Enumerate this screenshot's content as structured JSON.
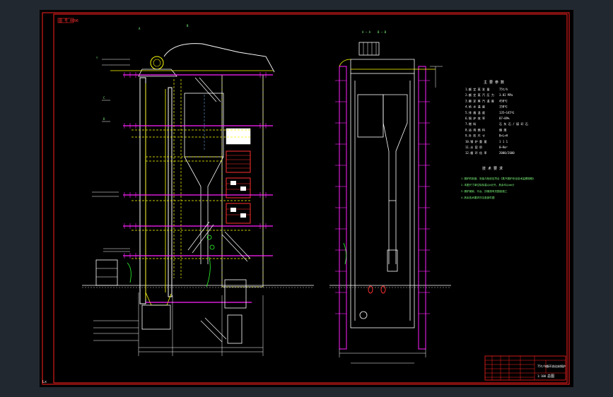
{
  "drawing": {
    "corner_tag": "图 号 0096",
    "view_label_left": "A — A",
    "view_label_right": "B — B",
    "spec_title": "主 要 参 数",
    "notes_title": "技 术 要 求",
    "spec_rows": [
      {
        "key": "1.额 定 蒸 发 量",
        "val": "75t/h"
      },
      {
        "key": "2.额 定 蒸 汽 压 力",
        "val": "3.82 MPa"
      },
      {
        "key": "3.额 定 蒸 汽 温 度",
        "val": "450℃"
      },
      {
        "key": "4.给 水 温 度",
        "val": "150℃"
      },
      {
        "key": "5.排 烟 温 度",
        "val": "135~145℃"
      },
      {
        "key": "6.锅 炉 效 率",
        "val": "87~89%"
      },
      {
        "key": "7.燃 料",
        "val": "石 灰 石 / 煤 矸 石"
      },
      {
        "key": "8.适 用 燃 料",
        "val": "烟 煤"
      },
      {
        "key": "9.外 形 尺 寸",
        "val": "B×L×H"
      },
      {
        "key": "10.锅 炉 重 量",
        "val": "1 1 1"
      },
      {
        "key": "11.水 容 积",
        "val": "8~9m³"
      },
      {
        "key": "12.循 环 倍 率",
        "val": "2000/2600"
      }
    ],
    "notes": [
      "1.锅炉的制造、安装与验收应符合《蒸汽锅炉安全技术监察规程》",
      "2.本图尺寸单位除标高以m计外，其余均以mm计",
      "3.锅炉钢架、平台、扶梯按有关图纸施工",
      "4.其余技术要求详见各部件图"
    ],
    "title_block": {
      "name": "75t/h循环流化床锅炉",
      "drawing_no": "总图",
      "sheet": "1:100"
    }
  }
}
